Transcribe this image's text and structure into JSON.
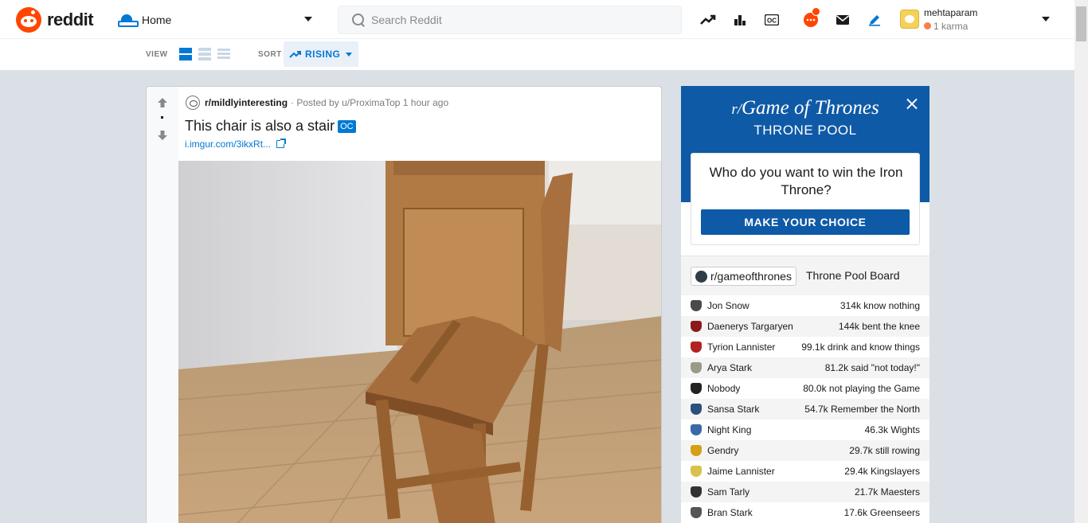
{
  "header": {
    "logo_text": "reddit",
    "feed_label": "Home",
    "search_placeholder": "Search Reddit",
    "user": {
      "name": "mehtaparam",
      "karma": "1 karma"
    },
    "icons": [
      "trending-icon",
      "stats-icon",
      "oc-icon",
      "chat-icon",
      "mail-icon",
      "pencil-icon"
    ]
  },
  "subbar": {
    "view_label": "VIEW",
    "sort_label": "SORT",
    "sort_value": "RISING"
  },
  "post": {
    "subreddit": "r/mildlyinteresting",
    "posted_by": "· Posted by u/ProximaTop 1 hour ago",
    "title": "This chair is also a stair",
    "flair": "OC",
    "link": "i.imgur.com/3ikxRt..."
  },
  "got_widget": {
    "subreddit_prefix": "r/",
    "title": "Game of Thrones",
    "subtitle": "THRONE POOL",
    "question": "Who do you want to win the Iron Throne?",
    "cta": "MAKE YOUR CHOICE",
    "board_chip": "r/gameofthrones",
    "board_title": "Throne Pool Board",
    "rows": [
      {
        "name": "Jon Snow",
        "value": "314k know nothing",
        "color": "#4a4a4a"
      },
      {
        "name": "Daenerys Targaryen",
        "value": "144k bent the knee",
        "color": "#8b1a1a"
      },
      {
        "name": "Tyrion Lannister",
        "value": "99.1k drink and know things",
        "color": "#b22222"
      },
      {
        "name": "Arya Stark",
        "value": "81.2k said \"not today!\"",
        "color": "#9a9a8a"
      },
      {
        "name": "Nobody",
        "value": "80.0k not playing the Game",
        "color": "#222222"
      },
      {
        "name": "Sansa Stark",
        "value": "54.7k Remember the North",
        "color": "#2d4f7c"
      },
      {
        "name": "Night King",
        "value": "46.3k Wights",
        "color": "#3a6aa8"
      },
      {
        "name": "Gendry",
        "value": "29.7k still rowing",
        "color": "#d4a017"
      },
      {
        "name": "Jaime Lannister",
        "value": "29.4k Kingslayers",
        "color": "#d9c24a"
      },
      {
        "name": "Sam Tarly",
        "value": "21.7k Maesters",
        "color": "#333333"
      },
      {
        "name": "Bran Stark",
        "value": "17.6k Greenseers",
        "color": "#555555"
      }
    ]
  }
}
